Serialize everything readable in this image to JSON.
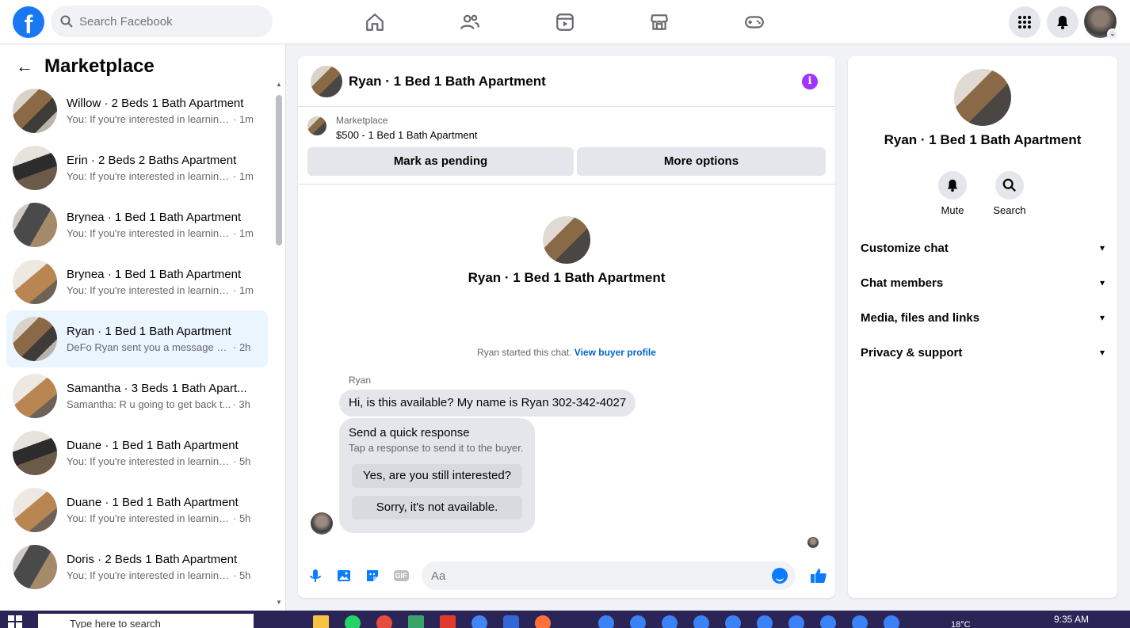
{
  "topbar": {
    "logo": "f",
    "search_placeholder": "Search Facebook",
    "nav_icons": [
      "home-icon",
      "friends-icon",
      "watch-icon",
      "marketplace-icon",
      "gaming-icon"
    ],
    "right_icons": [
      "menu-grid-icon",
      "notifications-bell-icon",
      "account-avatar"
    ]
  },
  "sidebar": {
    "back": "←",
    "title": "Marketplace",
    "conversations": [
      {
        "name": "Willow · 2 Beds 1 Bath Apartment",
        "snippet": "You: If you're interested in learning...",
        "time": "· 1m"
      },
      {
        "name": "Erin · 2 Beds 2 Baths Apartment",
        "snippet": "You: If you're interested in learning...",
        "time": "· 1m"
      },
      {
        "name": "Brynea · 1 Bed 1 Bath Apartment",
        "snippet": "You: If you're interested in learning...",
        "time": "· 1m"
      },
      {
        "name": "Brynea · 1 Bed 1 Bath Apartment",
        "snippet": "You: If you're interested in learning...",
        "time": "· 1m"
      },
      {
        "name": "Ryan · 1 Bed 1 Bath Apartment",
        "snippet": "DeFo Ryan sent you a message abo...",
        "time": "· 2h"
      },
      {
        "name": "Samantha · 3 Beds 1 Bath Apart...",
        "snippet": "Samantha: R u going to get back t...",
        "time": "· 3h"
      },
      {
        "name": "Duane · 1 Bed 1 Bath Apartment",
        "snippet": "You: If you're interested in learning ...",
        "time": "· 5h"
      },
      {
        "name": "Duane · 1 Bed 1 Bath Apartment",
        "snippet": "You: If you're interested in learning ...",
        "time": "· 5h"
      },
      {
        "name": "Doris · 2 Beds 1 Bath Apartment",
        "snippet": "You: If you're interested in learning ...",
        "time": "· 5h"
      }
    ]
  },
  "chat": {
    "header_title": "Ryan · 1 Bed 1 Bath Apartment",
    "info_icon": "i",
    "listing_source": "Marketplace",
    "listing_price": "$500 - 1 Bed 1 Bath Apartment",
    "mark_pending": "Mark as pending",
    "more_options": "More options",
    "intro_name": "Ryan · 1 Bed 1 Bath Apartment",
    "started_text": "Ryan started this chat.",
    "view_buyer": "View buyer profile",
    "sender": "Ryan",
    "message": "Hi, is this available? My name is Ryan 302-342-4027",
    "quick_title": "Send a quick response",
    "quick_sub": "Tap a response to send it to the buyer.",
    "quick_reply_1": "Yes, are you still interested?",
    "quick_reply_2": "Sorry, it's not available.",
    "composer_placeholder": "Aa",
    "gif_label": "GIF"
  },
  "right_panel": {
    "name": "Ryan · 1 Bed 1 Bath Apartment",
    "mute": "Mute",
    "search": "Search",
    "sections": [
      "Customize chat",
      "Chat members",
      "Media, files and links",
      "Privacy & support"
    ]
  },
  "taskbar": {
    "search_placeholder": "Type here to search",
    "temperature": "18°C",
    "time": "9:35 AM"
  },
  "colors": {
    "brand": "#1877f2",
    "accent": "#0a7cff",
    "info": "#a033ff",
    "active_row": "#ebf5ff"
  }
}
